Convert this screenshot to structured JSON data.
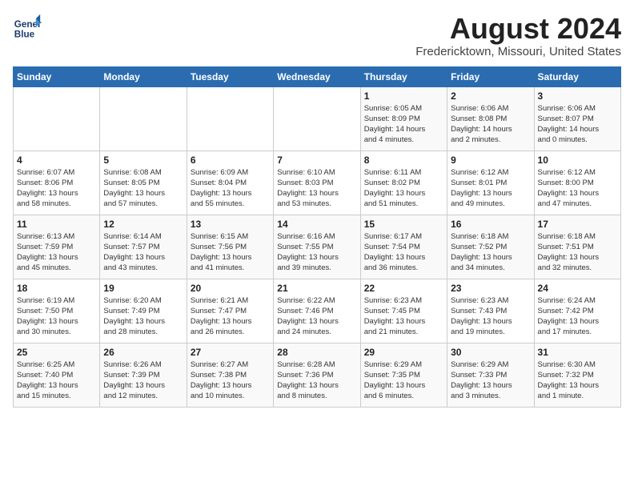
{
  "logo": {
    "line1": "General",
    "line2": "Blue"
  },
  "title": "August 2024",
  "subtitle": "Fredericktown, Missouri, United States",
  "days_of_week": [
    "Sunday",
    "Monday",
    "Tuesday",
    "Wednesday",
    "Thursday",
    "Friday",
    "Saturday"
  ],
  "weeks": [
    [
      {
        "day": "",
        "info": ""
      },
      {
        "day": "",
        "info": ""
      },
      {
        "day": "",
        "info": ""
      },
      {
        "day": "",
        "info": ""
      },
      {
        "day": "1",
        "info": "Sunrise: 6:05 AM\nSunset: 8:09 PM\nDaylight: 14 hours\nand 4 minutes."
      },
      {
        "day": "2",
        "info": "Sunrise: 6:06 AM\nSunset: 8:08 PM\nDaylight: 14 hours\nand 2 minutes."
      },
      {
        "day": "3",
        "info": "Sunrise: 6:06 AM\nSunset: 8:07 PM\nDaylight: 14 hours\nand 0 minutes."
      }
    ],
    [
      {
        "day": "4",
        "info": "Sunrise: 6:07 AM\nSunset: 8:06 PM\nDaylight: 13 hours\nand 58 minutes."
      },
      {
        "day": "5",
        "info": "Sunrise: 6:08 AM\nSunset: 8:05 PM\nDaylight: 13 hours\nand 57 minutes."
      },
      {
        "day": "6",
        "info": "Sunrise: 6:09 AM\nSunset: 8:04 PM\nDaylight: 13 hours\nand 55 minutes."
      },
      {
        "day": "7",
        "info": "Sunrise: 6:10 AM\nSunset: 8:03 PM\nDaylight: 13 hours\nand 53 minutes."
      },
      {
        "day": "8",
        "info": "Sunrise: 6:11 AM\nSunset: 8:02 PM\nDaylight: 13 hours\nand 51 minutes."
      },
      {
        "day": "9",
        "info": "Sunrise: 6:12 AM\nSunset: 8:01 PM\nDaylight: 13 hours\nand 49 minutes."
      },
      {
        "day": "10",
        "info": "Sunrise: 6:12 AM\nSunset: 8:00 PM\nDaylight: 13 hours\nand 47 minutes."
      }
    ],
    [
      {
        "day": "11",
        "info": "Sunrise: 6:13 AM\nSunset: 7:59 PM\nDaylight: 13 hours\nand 45 minutes."
      },
      {
        "day": "12",
        "info": "Sunrise: 6:14 AM\nSunset: 7:57 PM\nDaylight: 13 hours\nand 43 minutes."
      },
      {
        "day": "13",
        "info": "Sunrise: 6:15 AM\nSunset: 7:56 PM\nDaylight: 13 hours\nand 41 minutes."
      },
      {
        "day": "14",
        "info": "Sunrise: 6:16 AM\nSunset: 7:55 PM\nDaylight: 13 hours\nand 39 minutes."
      },
      {
        "day": "15",
        "info": "Sunrise: 6:17 AM\nSunset: 7:54 PM\nDaylight: 13 hours\nand 36 minutes."
      },
      {
        "day": "16",
        "info": "Sunrise: 6:18 AM\nSunset: 7:52 PM\nDaylight: 13 hours\nand 34 minutes."
      },
      {
        "day": "17",
        "info": "Sunrise: 6:18 AM\nSunset: 7:51 PM\nDaylight: 13 hours\nand 32 minutes."
      }
    ],
    [
      {
        "day": "18",
        "info": "Sunrise: 6:19 AM\nSunset: 7:50 PM\nDaylight: 13 hours\nand 30 minutes."
      },
      {
        "day": "19",
        "info": "Sunrise: 6:20 AM\nSunset: 7:49 PM\nDaylight: 13 hours\nand 28 minutes."
      },
      {
        "day": "20",
        "info": "Sunrise: 6:21 AM\nSunset: 7:47 PM\nDaylight: 13 hours\nand 26 minutes."
      },
      {
        "day": "21",
        "info": "Sunrise: 6:22 AM\nSunset: 7:46 PM\nDaylight: 13 hours\nand 24 minutes."
      },
      {
        "day": "22",
        "info": "Sunrise: 6:23 AM\nSunset: 7:45 PM\nDaylight: 13 hours\nand 21 minutes."
      },
      {
        "day": "23",
        "info": "Sunrise: 6:23 AM\nSunset: 7:43 PM\nDaylight: 13 hours\nand 19 minutes."
      },
      {
        "day": "24",
        "info": "Sunrise: 6:24 AM\nSunset: 7:42 PM\nDaylight: 13 hours\nand 17 minutes."
      }
    ],
    [
      {
        "day": "25",
        "info": "Sunrise: 6:25 AM\nSunset: 7:40 PM\nDaylight: 13 hours\nand 15 minutes."
      },
      {
        "day": "26",
        "info": "Sunrise: 6:26 AM\nSunset: 7:39 PM\nDaylight: 13 hours\nand 12 minutes."
      },
      {
        "day": "27",
        "info": "Sunrise: 6:27 AM\nSunset: 7:38 PM\nDaylight: 13 hours\nand 10 minutes."
      },
      {
        "day": "28",
        "info": "Sunrise: 6:28 AM\nSunset: 7:36 PM\nDaylight: 13 hours\nand 8 minutes."
      },
      {
        "day": "29",
        "info": "Sunrise: 6:29 AM\nSunset: 7:35 PM\nDaylight: 13 hours\nand 6 minutes."
      },
      {
        "day": "30",
        "info": "Sunrise: 6:29 AM\nSunset: 7:33 PM\nDaylight: 13 hours\nand 3 minutes."
      },
      {
        "day": "31",
        "info": "Sunrise: 6:30 AM\nSunset: 7:32 PM\nDaylight: 13 hours\nand 1 minute."
      }
    ]
  ]
}
